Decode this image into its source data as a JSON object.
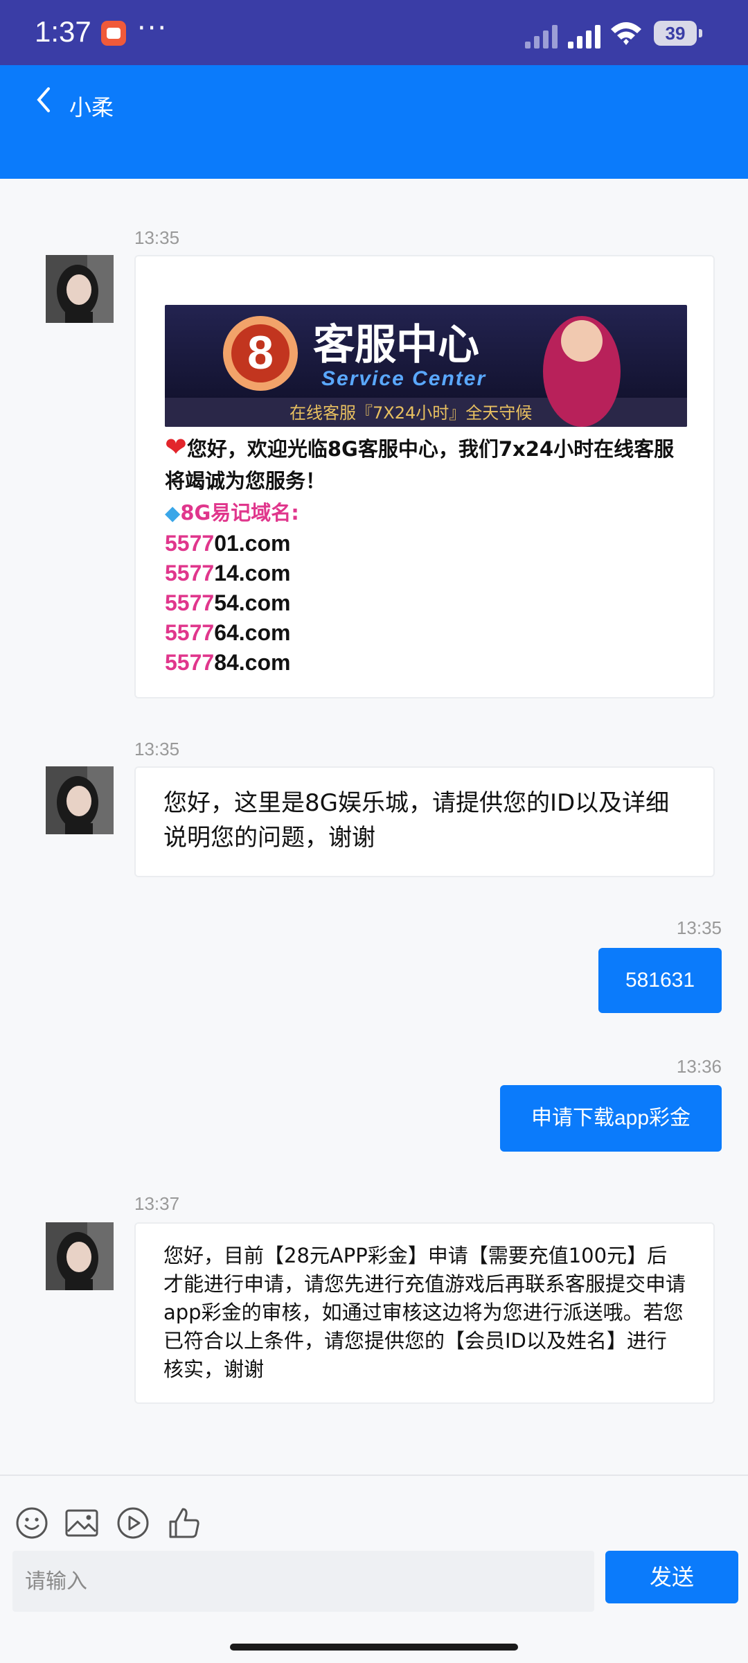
{
  "status_bar": {
    "time": "1:37",
    "dots": "···",
    "battery": "39"
  },
  "header": {
    "title": "小柔",
    "back_icon": "chevron-left-icon"
  },
  "messages": [
    {
      "time": "13:35",
      "banner": {
        "logo_char": "8",
        "title": "客服中心",
        "subtitle": "Service Center",
        "footer": "在线客服『7X24小时』全天守候"
      },
      "welcome_line": "您好，欢迎光临8G客服中心，我们7x24小时在线客服将竭诚为您服务！",
      "domain_title": "8G易记域名:",
      "domains": [
        {
          "prefix": "5577",
          "suffix": "01.com"
        },
        {
          "prefix": "5577",
          "suffix": "14.com"
        },
        {
          "prefix": "5577",
          "suffix": "54.com"
        },
        {
          "prefix": "5577",
          "suffix": "64.com"
        },
        {
          "prefix": "5577",
          "suffix": "84.com"
        }
      ]
    },
    {
      "time": "13:35",
      "text": "您好，这里是8G娱乐城，请提供您的ID以及详细说明您的问题，谢谢"
    },
    {
      "time": "13:35",
      "text": "581631"
    },
    {
      "time": "13:36",
      "text": "申请下载app彩金"
    },
    {
      "time": "13:37",
      "text": "您好，目前【28元APP彩金】申请【需要充值100元】后才能进行申请，请您先进行充值游戏后再联系客服提交申请app彩金的审核，如通过审核这边将为您进行派送哦。若您已符合以上条件，请您提供您的【会员ID以及姓名】进行核实，谢谢"
    }
  ],
  "input": {
    "placeholder": "请输入",
    "value": ""
  },
  "send_label": "发送",
  "toolbar_icons": [
    "emoji-icon",
    "image-icon",
    "video-play-icon",
    "thumbs-up-icon"
  ],
  "colors": {
    "status_bar": "#3a3da6",
    "header": "#0b7bfb",
    "outgoing_bubble": "#0b7bfb",
    "domain_pink": "#e0368c"
  }
}
